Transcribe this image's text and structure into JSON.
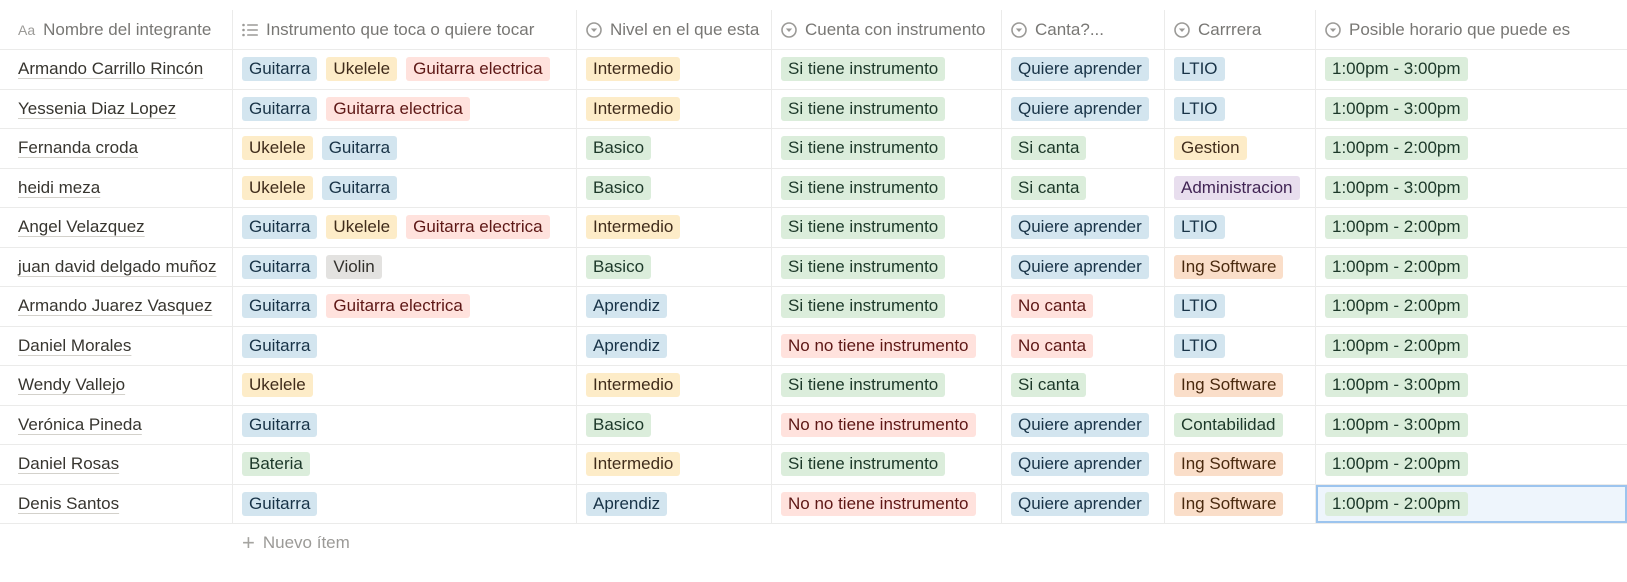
{
  "columns": [
    {
      "label": "Nombre del integrante",
      "icon": "title-property-icon"
    },
    {
      "label": "Instrumento que toca o quiere tocar",
      "icon": "multi-select-icon"
    },
    {
      "label": "Nivel en el que esta",
      "icon": "select-icon"
    },
    {
      "label": "Cuenta con instrumento",
      "icon": "select-icon"
    },
    {
      "label": "Canta?...",
      "icon": "select-icon"
    },
    {
      "label": "Carrrera",
      "icon": "select-icon"
    },
    {
      "label": "Posible horario que puede es",
      "icon": "select-icon"
    }
  ],
  "header_aa": "Aa",
  "rows": [
    {
      "name": "Armando Carrillo Rincón",
      "instruments": [
        "Guitarra",
        "Ukelele",
        "Guitarra electrica"
      ],
      "nivel": "Intermedio",
      "cuenta": "Si tiene instrumento",
      "canta": "Quiere aprender",
      "carrera": "LTIO",
      "horario": "1:00pm - 3:00pm"
    },
    {
      "name": "Yessenia Diaz Lopez",
      "instruments": [
        "Guitarra",
        "Guitarra electrica"
      ],
      "nivel": "Intermedio",
      "cuenta": "Si tiene instrumento",
      "canta": "Quiere aprender",
      "carrera": "LTIO",
      "horario": "1:00pm - 3:00pm"
    },
    {
      "name": "Fernanda croda",
      "instruments": [
        "Ukelele",
        "Guitarra"
      ],
      "nivel": "Basico",
      "cuenta": "Si tiene instrumento",
      "canta": "Si canta",
      "carrera": "Gestion",
      "horario": "1:00pm - 2:00pm"
    },
    {
      "name": "heidi meza",
      "instruments": [
        "Ukelele",
        "Guitarra"
      ],
      "nivel": "Basico",
      "cuenta": "Si tiene instrumento",
      "canta": "Si canta",
      "carrera": "Administracion",
      "horario": "1:00pm - 3:00pm"
    },
    {
      "name": "Angel Velazquez",
      "instruments": [
        "Guitarra",
        "Ukelele",
        "Guitarra electrica"
      ],
      "nivel": "Intermedio",
      "cuenta": "Si tiene instrumento",
      "canta": "Quiere aprender",
      "carrera": "LTIO",
      "horario": "1:00pm - 2:00pm"
    },
    {
      "name": "juan david delgado muñoz",
      "instruments": [
        "Guitarra",
        "Violin"
      ],
      "nivel": "Basico",
      "cuenta": "Si tiene instrumento",
      "canta": "Quiere aprender",
      "carrera": "Ing Software",
      "horario": "1:00pm - 2:00pm"
    },
    {
      "name": "Armando Juarez Vasquez",
      "instruments": [
        "Guitarra",
        "Guitarra electrica"
      ],
      "nivel": "Aprendiz",
      "cuenta": "Si tiene instrumento",
      "canta": "No canta",
      "carrera": "LTIO",
      "horario": "1:00pm - 2:00pm"
    },
    {
      "name": "Daniel Morales",
      "instruments": [
        "Guitarra"
      ],
      "nivel": "Aprendiz",
      "cuenta": "No no tiene instrumento",
      "canta": "No canta",
      "carrera": "LTIO",
      "horario": "1:00pm - 2:00pm"
    },
    {
      "name": "Wendy Vallejo",
      "instruments": [
        "Ukelele"
      ],
      "nivel": "Intermedio",
      "cuenta": "Si tiene instrumento",
      "canta": "Si canta",
      "carrera": "Ing Software",
      "horario": "1:00pm - 3:00pm"
    },
    {
      "name": "Verónica Pineda",
      "instruments": [
        "Guitarra"
      ],
      "nivel": "Basico",
      "cuenta": "No no tiene instrumento",
      "canta": "Quiere aprender",
      "carrera": "Contabilidad",
      "horario": "1:00pm - 3:00pm"
    },
    {
      "name": "Daniel Rosas",
      "instruments": [
        "Bateria"
      ],
      "nivel": "Intermedio",
      "cuenta": "Si tiene instrumento",
      "canta": "Quiere aprender",
      "carrera": "Ing Software",
      "horario": "1:00pm - 2:00pm"
    },
    {
      "name": "Denis Santos",
      "instruments": [
        "Guitarra"
      ],
      "nivel": "Aprendiz",
      "cuenta": "No no tiene instrumento",
      "canta": "Quiere aprender",
      "carrera": "Ing Software",
      "horario": "1:00pm - 2:00pm"
    }
  ],
  "tag_colors": {
    "Guitarra": "blue",
    "Ukelele": "yellow",
    "Guitarra electrica": "red",
    "Violin": "gray",
    "Bateria": "green",
    "Intermedio": "yellow",
    "Basico": "green",
    "Aprendiz": "blue",
    "Si tiene instrumento": "green",
    "No no tiene instrumento": "red",
    "Quiere aprender": "blue",
    "Si canta": "green",
    "No canta": "red",
    "LTIO": "blue",
    "Gestion": "yellow",
    "Administracion": "purple",
    "Ing Software": "orange",
    "Contabilidad": "green",
    "1:00pm - 3:00pm": "green",
    "1:00pm - 2:00pm": "green"
  },
  "selected_cell": {
    "row": 11,
    "column": "horario"
  },
  "new_item_label": "Nuevo ítem"
}
